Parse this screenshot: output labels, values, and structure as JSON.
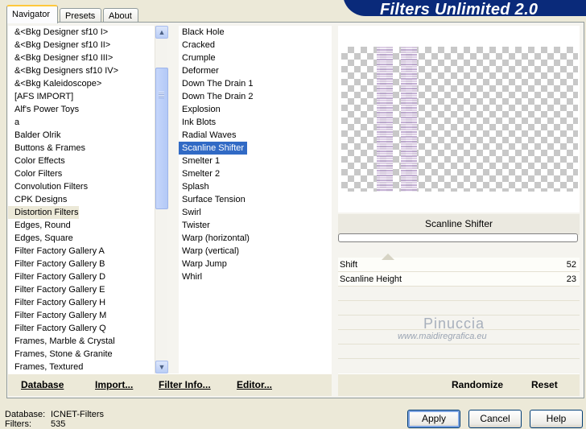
{
  "tabs": [
    {
      "label": "Navigator",
      "active": true
    },
    {
      "label": "Presets",
      "active": false
    },
    {
      "label": "About",
      "active": false
    }
  ],
  "logo_text": "Filters Unlimited 2.0",
  "categories": [
    "&<Bkg Designer sf10 I>",
    "&<Bkg Designer sf10 II>",
    "&<Bkg Designer sf10 III>",
    "&<Bkg Designers sf10 IV>",
    "&<Bkg Kaleidoscope>",
    "[AFS IMPORT]",
    "Alf's Power Toys",
    "a",
    "Balder Olrik",
    "Buttons & Frames",
    "Color Effects",
    "Color Filters",
    "Convolution Filters",
    "CPK Designs",
    "Distortion Filters",
    "Edges, Round",
    "Edges, Square",
    "Filter Factory Gallery A",
    "Filter Factory Gallery B",
    "Filter Factory Gallery D",
    "Filter Factory Gallery E",
    "Filter Factory Gallery H",
    "Filter Factory Gallery M",
    "Filter Factory Gallery Q",
    "Frames, Marble & Crystal",
    "Frames, Stone & Granite",
    "Frames, Textured"
  ],
  "selected_category": "Distortion Filters",
  "filters": [
    "Black Hole",
    "Cracked",
    "Crumple",
    "Deformer",
    "Down The Drain 1",
    "Down The Drain 2",
    "Explosion",
    "Ink Blots",
    "Radial Waves",
    "Scanline Shifter",
    "Smelter 1",
    "Smelter 2",
    "Splash",
    "Surface Tension",
    "Swirl",
    "Twister",
    "Warp (horizontal)",
    "Warp (vertical)",
    "Warp Jump",
    "Whirl"
  ],
  "selected_filter": "Scanline Shifter",
  "filter_title": "Scanline Shifter",
  "params": [
    {
      "name": "Shift",
      "value": "52"
    },
    {
      "name": "Scanline Height",
      "value": "23"
    }
  ],
  "watermark": {
    "name": "Pinuccia",
    "url": "www.maidiregrafica.eu"
  },
  "bottom_buttons": {
    "database": "Database",
    "import": "Import...",
    "filter_info": "Filter Info...",
    "editor": "Editor...",
    "randomize": "Randomize",
    "reset": "Reset"
  },
  "status": {
    "database_label": "Database:",
    "database_value": "ICNET-Filters",
    "filters_label": "Filters:",
    "filters_value": "535"
  },
  "dialog_buttons": {
    "apply": "Apply",
    "cancel": "Cancel",
    "help": "Help"
  },
  "colors": {
    "selection": "#316ac5",
    "logo_bg": "#0a2a7a"
  }
}
